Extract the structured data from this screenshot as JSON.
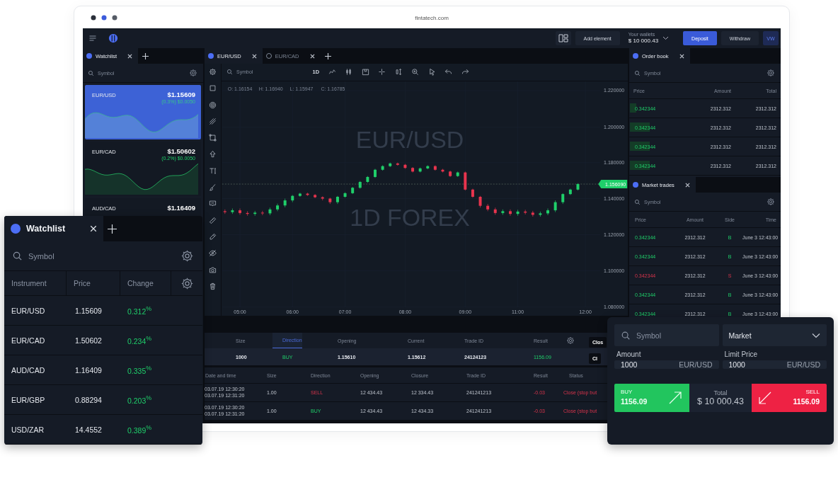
{
  "browser": {
    "url": "fintatech.com"
  },
  "topbar": {
    "add_element": "Add element",
    "wallet_label": "Your wallets",
    "wallet_value": "$ 10 000.43",
    "deposit": "Deposit",
    "withdraw": "Withdraw",
    "avatar": "VW"
  },
  "watchlist_panel": {
    "tabs": [
      {
        "label": "Watchlist",
        "selected": true
      }
    ],
    "search": {
      "placeholder": "Symbol"
    },
    "cards": [
      {
        "symbol": "EUR/USD",
        "price": "$1.15609",
        "change": "(0.3%) $0.0050",
        "selected": true
      },
      {
        "symbol": "EUR/CAD",
        "price": "$1.50602",
        "change": "(0.2%) $0.0050",
        "selected": false
      },
      {
        "symbol": "AUD/CAD",
        "price": "$1.16409",
        "selected": false
      }
    ]
  },
  "chart_tabs": [
    {
      "label": "EUR/USD",
      "selected": true
    },
    {
      "label": "EUR/CAD",
      "selected": false
    }
  ],
  "chart_toolbar": {
    "search": {
      "placeholder": "Symbol"
    },
    "interval": "1D"
  },
  "chart": {
    "upper_axis_labels": [
      "1.220000",
      "1.200000",
      "1.180000"
    ],
    "ohlc_legend": [
      "O: 1.16154",
      "H: 1.16940",
      "L: 1.15947",
      "C: 1.16785"
    ],
    "watermark": [
      "EUR/USD",
      "1D FOREX"
    ],
    "last_price": "1.156090",
    "chart_data": {
      "type": "candlestick",
      "categories": [
        null,
        null,
        "05:00",
        null,
        null,
        null,
        null,
        null,
        null,
        "06:00",
        null,
        null,
        null,
        null,
        null,
        null,
        "07:00",
        null,
        null,
        null,
        null,
        null,
        null,
        null,
        "08:00",
        null,
        null,
        null,
        null,
        null,
        null,
        null,
        "09:00",
        null,
        null,
        null,
        null,
        null,
        null,
        "11:00",
        null,
        null,
        null,
        null,
        null,
        null,
        null,
        null,
        "12:00"
      ],
      "ohlc": [
        [
          1.133,
          1.134,
          1.1315,
          1.1325
        ],
        [
          1.1325,
          1.1345,
          1.1315,
          1.1335
        ],
        [
          1.1335,
          1.1345,
          1.131,
          1.132
        ],
        [
          1.132,
          1.133,
          1.1305,
          1.1315
        ],
        [
          1.1315,
          1.1332,
          1.1305,
          1.1322
        ],
        [
          1.1322,
          1.1332,
          1.1308,
          1.1318
        ],
        [
          1.1318,
          1.135,
          1.1308,
          1.134
        ],
        [
          1.134,
          1.1372,
          1.133,
          1.1362
        ],
        [
          1.1362,
          1.14,
          1.1352,
          1.139
        ],
        [
          1.139,
          1.142,
          1.138,
          1.1415
        ],
        [
          1.1415,
          1.14325,
          1.141,
          1.14275
        ],
        [
          1.14275,
          1.14325,
          1.1415,
          1.142
        ],
        [
          1.142,
          1.1425,
          1.14025,
          1.14075
        ],
        [
          1.14075,
          1.14125,
          1.139,
          1.14
        ],
        [
          1.14,
          1.1405,
          1.137,
          1.138
        ],
        [
          1.138,
          1.1415,
          1.137,
          1.141
        ],
        [
          1.141,
          1.1435,
          1.1405,
          1.143
        ],
        [
          1.143,
          1.1465,
          1.1425,
          1.146
        ],
        [
          1.146,
          1.14975,
          1.1455,
          1.14925
        ],
        [
          1.14925,
          1.1525,
          1.14875,
          1.152
        ],
        [
          1.152,
          1.1565,
          1.1515,
          1.156
        ],
        [
          1.156,
          1.1585,
          1.1555,
          1.158
        ],
        [
          1.158,
          1.16,
          1.1575,
          1.1595
        ],
        [
          1.1595,
          1.16,
          1.15825,
          1.15875
        ],
        [
          1.15875,
          1.15925,
          1.1565,
          1.157
        ],
        [
          1.157,
          1.1575,
          1.1545,
          1.155
        ],
        [
          1.155,
          1.15725,
          1.1545,
          1.15675
        ],
        [
          1.15675,
          1.1585,
          1.15625,
          1.158
        ],
        [
          1.158,
          1.1585,
          1.1555,
          1.156
        ],
        [
          1.156,
          1.1565,
          1.1545,
          1.155
        ],
        [
          1.155,
          1.1555,
          1.152,
          1.1525
        ],
        [
          1.1525,
          1.155,
          1.152,
          1.1545
        ],
        [
          1.1545,
          1.155,
          1.1445,
          1.145
        ],
        [
          1.145,
          1.1455,
          1.1405,
          1.141
        ],
        [
          1.141,
          1.1415,
          1.135,
          1.136
        ],
        [
          1.136,
          1.137,
          1.133,
          1.134
        ],
        [
          1.134,
          1.135,
          1.131,
          1.132
        ],
        [
          1.132,
          1.134,
          1.131,
          1.133
        ],
        [
          1.133,
          1.134,
          1.1305,
          1.1315
        ],
        [
          1.1315,
          1.1338,
          1.1305,
          1.1328
        ],
        [
          1.1328,
          1.1338,
          1.1312,
          1.1322
        ],
        [
          1.1322,
          1.1332,
          1.13,
          1.131
        ],
        [
          1.131,
          1.1328,
          1.13,
          1.1318
        ],
        [
          1.1318,
          1.1345,
          1.1308,
          1.1335
        ],
        [
          1.1335,
          1.139,
          1.1325,
          1.138
        ],
        [
          1.138,
          1.143,
          1.137,
          1.1425
        ],
        [
          1.1425,
          1.1455,
          1.142,
          1.145
        ],
        [
          1.145,
          1.14855,
          1.1445,
          1.14805
        ],
        null
      ],
      "ylim": [
        1.08,
        1.205
      ],
      "grid": true,
      "ref_lines": [
        {
          "axis": "y",
          "value": 1.14805
        }
      ],
      "yticks": [
        {
          "value": 1.14,
          "label": "1.140000"
        },
        {
          "value": 1.12,
          "label": "1.120000"
        },
        {
          "value": 1.1,
          "label": "1.100000"
        },
        {
          "value": 1.08,
          "label": "1.080000"
        }
      ]
    }
  },
  "positions": {
    "columns": [
      {
        "label": "Size",
        "selected": false
      },
      {
        "label": "Direction",
        "selected": true
      },
      {
        "label": "Opening",
        "selected": false
      },
      {
        "label": "Current",
        "selected": false
      },
      {
        "label": "Trade ID",
        "selected": false
      },
      {
        "label": "Result",
        "selected": false
      }
    ],
    "header_button": "Clos",
    "rows": [
      {
        "size": "1000",
        "direction": "BUY",
        "kind": "buy",
        "opening": "1.15610",
        "current": "1.15612",
        "trade_id": "24124123",
        "result": "1156.09",
        "button": "Cl"
      }
    ]
  },
  "history": {
    "columns": [
      "Date and time",
      "Size",
      "Direction",
      "Opening",
      "Closure",
      "Trade ID",
      "Result",
      "Status"
    ],
    "rows": [
      {
        "opened": "03.07.19 12:30:20",
        "closed": "03.07.19 12:31:20",
        "size": "1.00",
        "direction": "SELL",
        "kind": "sell",
        "opening": "12 434.43",
        "closure": "12 334.43",
        "trade_id": "241241213",
        "result": "-0.03",
        "status": "Close (stop but"
      },
      {
        "opened": "03.07.19 12:30:20",
        "closed": "03.07.19 12:31:20",
        "size": "1.00",
        "direction": "BUY",
        "kind": "buy",
        "opening": "12 434.43",
        "closure": "12 434.33",
        "trade_id": "241241213",
        "result": "-0.03",
        "status": "Close (stop but"
      }
    ]
  },
  "order_book": {
    "tabs": [
      {
        "label": "Order book",
        "selected": true
      }
    ],
    "search": {
      "placeholder": "Symbol"
    },
    "columns": [
      "Price",
      "Amount",
      "Total"
    ],
    "rows": [
      {
        "price": "0.342344",
        "amount": "2312.312",
        "total": "2312.312",
        "level": 0.04
      },
      {
        "price": "0.342344",
        "amount": "2312.312",
        "total": "2312.312",
        "level": 0.13
      },
      {
        "price": "0.342344",
        "amount": "2312.312",
        "total": "2312.312",
        "level": 0.13
      },
      {
        "price": "0.342344",
        "amount": "2312.312",
        "total": "2312.312",
        "level": 0.13
      }
    ]
  },
  "market_trades": {
    "tabs": [
      {
        "label": "Market trades",
        "selected": true
      }
    ],
    "search": {
      "placeholder": "Symbol"
    },
    "columns": [
      "Price",
      "Amount",
      "Side",
      "Time"
    ],
    "rows": [
      {
        "price": "0.342344",
        "amount": "2312.312",
        "side": "B",
        "kind": "buy",
        "time": "June 3 12:43:00"
      },
      {
        "price": "0.342344",
        "amount": "2312.312",
        "side": "B",
        "kind": "buy",
        "time": "June 3 12:43:00"
      },
      {
        "price": "0.342344",
        "amount": "2312.312",
        "side": "S",
        "kind": "sell",
        "time": "June 3 12:43:00"
      },
      {
        "price": "0.342344",
        "amount": "2312.312",
        "side": "B",
        "kind": "buy",
        "time": "June 3 12:43:00"
      },
      {
        "price": "0.342344",
        "amount": "2312.312",
        "side": "B",
        "kind": "buy",
        "time": "June 3 12:43:00"
      }
    ]
  },
  "watchlist_popup": {
    "tabs": [
      {
        "label": "Watchlist",
        "selected": true
      }
    ],
    "search": {
      "placeholder": "Symbol"
    },
    "columns": [
      "Instrument",
      "Price",
      "Change"
    ],
    "rows": [
      {
        "instrument": "EUR/USD",
        "price": "1.15609",
        "change": "0.312$^{%}$"
      },
      {
        "instrument": "EUR/CAD",
        "price": "1.50602",
        "change": "0.234$^{%}$"
      },
      {
        "instrument": "AUD/CAD",
        "price": "1.16409",
        "change": "0.335$^{%}$"
      },
      {
        "instrument": "EUR/GBP",
        "price": "0.88294",
        "change": "0.203$^{%}$"
      },
      {
        "instrument": "USD/ZAR",
        "price": "14.4552",
        "change": "0.389$^{%}$"
      }
    ]
  },
  "order_form": {
    "search": {
      "placeholder": "Symbol"
    },
    "order_type": "Market",
    "fields": [
      {
        "label": "Amount",
        "value": "1000",
        "unit": "EUR/USD"
      },
      {
        "label": "Limit Price",
        "value": "1000",
        "unit": "EUR/USD"
      }
    ],
    "buy": {
      "label": "BUY",
      "price": "1156.09"
    },
    "total": {
      "label": "Total",
      "value": "$ 10 000.43"
    },
    "sell": {
      "label": "SELL",
      "price": "1156.09"
    }
  }
}
